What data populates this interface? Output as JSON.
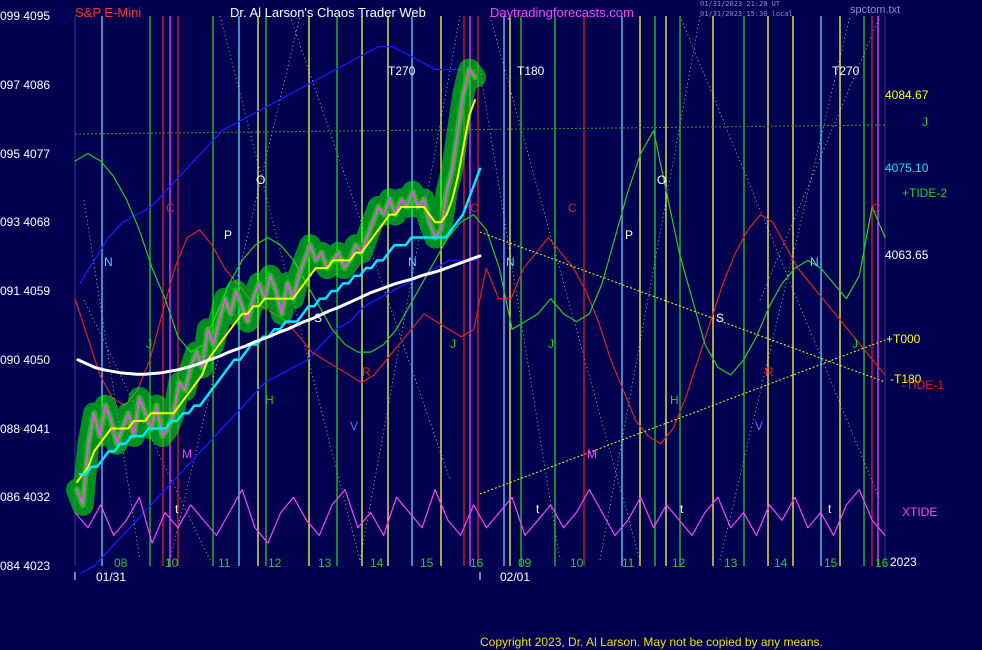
{
  "header": {
    "symbol": "S&P E-Mini",
    "author": "Dr. Al Larson's Chaos Trader Web",
    "site": "Daytradingforecasts.com",
    "stamp_line1": "01/31/2023 21:20 UT",
    "stamp_line2": "01/31/2023 15:30 local",
    "file": "spctom.txt"
  },
  "footer": {
    "copyright": "Copyright 2023, Dr. Al Larson. May not be copied by any means."
  },
  "colors": {
    "background": "#000050",
    "price_bar": "#00d000",
    "price_glow": "#00ff00",
    "fast_avg": "#ffff00",
    "mid_avg": "#00e8ff",
    "slow_avg": "#ffffff",
    "tide1": "#e02020",
    "tide2": "#20d020",
    "xtide": "#ff40ff",
    "envelope": "#1a1aff",
    "neptune_line": "#5cd8ff",
    "vertical_green": "#20d020",
    "vertical_yellow": "#ffff40",
    "vertical_red": "#e02020",
    "vertical_magenta": "#ff40ff"
  },
  "chart_data": {
    "type": "line",
    "title": "S&P E-Mini",
    "ylim": [
      4023,
      4095
    ],
    "y_ticks": [
      {
        "left": "099",
        "right": "4095",
        "value": 4095
      },
      {
        "left": "097",
        "right": "4086",
        "value": 4086
      },
      {
        "left": "095",
        "right": "4077",
        "value": 4077
      },
      {
        "left": "093",
        "right": "4068",
        "value": 4068
      },
      {
        "left": "091",
        "right": "4059",
        "value": 4059
      },
      {
        "left": "090",
        "right": "4050",
        "value": 4050
      },
      {
        "left": "088",
        "right": "4041",
        "value": 4041
      },
      {
        "left": "086",
        "right": "4032",
        "value": 4032
      },
      {
        "left": "084",
        "right": "4023",
        "value": 4023
      }
    ],
    "hour_labels": [
      "08",
      "10",
      "11",
      "12",
      "13",
      "14",
      "15",
      "16",
      "09",
      "10",
      "11",
      "12",
      "13",
      "14",
      "15",
      "16"
    ],
    "date_labels": [
      "01/31",
      "02/01"
    ],
    "right_levels": [
      {
        "label": "4084.67",
        "value": 4084.67,
        "color": "#ffff00"
      },
      {
        "label": "4075.10",
        "value": 4075.1,
        "color": "#00e8ff"
      },
      {
        "label": "4063.65",
        "value": 4063.65,
        "color": "#ffffff"
      }
    ],
    "right_series_labels": [
      {
        "label": "J",
        "color": "#20d020"
      },
      {
        "label": "+TIDE-2",
        "color": "#20d020"
      },
      {
        "label": "+T000",
        "color": "#ffff00"
      },
      {
        "label": "-T180",
        "color": "#ffff00"
      },
      {
        "label": "-TIDE-1",
        "color": "#e02020"
      },
      {
        "label": "XTIDE",
        "color": "#ff40ff"
      },
      {
        "label": "2023",
        "color": "#ffffff"
      }
    ],
    "time_markers": [
      {
        "label": "T270",
        "color": "#ffffff"
      },
      {
        "label": "T180",
        "color": "#ffffff"
      },
      {
        "label": "T270",
        "color": "#ffffff"
      }
    ],
    "planet_letters": [
      {
        "label": "N",
        "color": "#5cd8ff"
      },
      {
        "label": "C",
        "color": "#e02020"
      },
      {
        "label": "P",
        "color": "#ffffff"
      },
      {
        "label": "O",
        "color": "#ffffff"
      },
      {
        "label": "J",
        "color": "#20d020"
      },
      {
        "label": "S",
        "color": "#ffffff"
      },
      {
        "label": "H",
        "color": "#20d020"
      },
      {
        "label": "M",
        "color": "#ff40ff"
      },
      {
        "label": "R",
        "color": "#e02020"
      },
      {
        "label": "V",
        "color": "#6a6aff"
      },
      {
        "label": "t",
        "color": "#ffffff"
      },
      {
        "label": "N",
        "color": "#5cd8ff"
      },
      {
        "label": "J",
        "color": "#20d020"
      },
      {
        "label": "N",
        "color": "#5cd8ff"
      },
      {
        "label": "C",
        "color": "#e02020"
      },
      {
        "label": "C",
        "color": "#e02020"
      },
      {
        "label": "P",
        "color": "#ffffff"
      },
      {
        "label": "O",
        "color": "#ffffff"
      },
      {
        "label": "J",
        "color": "#20d020"
      },
      {
        "label": "S",
        "color": "#ffffff"
      },
      {
        "label": "M",
        "color": "#ff40ff"
      },
      {
        "label": "H",
        "color": "#20d020"
      },
      {
        "label": "R",
        "color": "#e02020"
      },
      {
        "label": "N",
        "color": "#5cd8ff"
      },
      {
        "label": "J",
        "color": "#20d020"
      },
      {
        "label": "C",
        "color": "#e02020"
      },
      {
        "label": "V",
        "color": "#6a6aff"
      },
      {
        "label": "t",
        "color": "#ffffff"
      },
      {
        "label": "t",
        "color": "#ffffff"
      },
      {
        "label": "t",
        "color": "#ffffff"
      }
    ],
    "price": [
      4033,
      4031,
      4039,
      4043,
      4040,
      4044,
      4042,
      4039,
      4041,
      4043,
      4040,
      4045,
      4043,
      4041,
      4044,
      4040,
      4041,
      4043,
      4047,
      4046,
      4049,
      4051,
      4049,
      4054,
      4052,
      4055,
      4058,
      4056,
      4059,
      4057,
      4055,
      4058,
      4060,
      4058,
      4061,
      4059,
      4056,
      4060,
      4058,
      4061,
      4063,
      4065,
      4063,
      4064,
      4062,
      4063,
      4064,
      4062,
      4063,
      4065,
      4064,
      4066,
      4068,
      4070,
      4069,
      4071,
      4069,
      4071,
      4070,
      4072,
      4070,
      4071,
      4068,
      4066,
      4067,
      4072,
      4075,
      4080,
      4085,
      4088,
      4087
    ],
    "fast_avg": [
      4034,
      4035,
      4036,
      4038,
      4039,
      4040,
      4041,
      4041,
      4041,
      4041,
      4042,
      4042,
      4042,
      4043,
      4043,
      4043,
      4043,
      4043,
      4044,
      4045,
      4046,
      4047,
      4048,
      4050,
      4051,
      4052,
      4053,
      4054,
      4055,
      4056,
      4056,
      4057,
      4057,
      4058,
      4058,
      4058,
      4058,
      4058,
      4058,
      4059,
      4060,
      4061,
      4062,
      4062,
      4062,
      4063,
      4063,
      4063,
      4063,
      4064,
      4064,
      4065,
      4066,
      4067,
      4068,
      4069,
      4069,
      4070,
      4070,
      4070,
      4070,
      4070,
      4069,
      4068,
      4068,
      4069,
      4071,
      4074,
      4078,
      4082,
      4084
    ],
    "mid_avg": [
      4035,
      4035,
      4036,
      4036,
      4037,
      4038,
      4038,
      4039,
      4039,
      4040,
      4040,
      4040,
      4041,
      4041,
      4041,
      4041,
      4042,
      4042,
      4043,
      4043,
      4044,
      4044,
      4045,
      4046,
      4047,
      4048,
      4049,
      4050,
      4050,
      4051,
      4052,
      4052,
      4053,
      4053,
      4054,
      4054,
      4055,
      4055,
      4055,
      4056,
      4057,
      4057,
      4058,
      4058,
      4059,
      4059,
      4060,
      4060,
      4061,
      4061,
      4062,
      4062,
      4063,
      4063,
      4064,
      4065,
      4065,
      4065,
      4066,
      4066,
      4066,
      4066,
      4066,
      4066,
      4066,
      4067,
      4068,
      4069,
      4071,
      4073,
      4075
    ],
    "slow_avg": [
      4050,
      4049.5,
      4049,
      4048.7,
      4048.5,
      4048.3,
      4048.2,
      4048.1,
      4048.1,
      4048.2,
      4048.3,
      4048.5,
      4048.7,
      4049,
      4049.3,
      4049.7,
      4050.1,
      4050.5,
      4051,
      4051.4,
      4051.8,
      4052.3,
      4052.7,
      4053.1,
      4053.6,
      4054,
      4054.5,
      4055,
      4055.4,
      4055.9,
      4056.4,
      4056.8,
      4057.3,
      4057.8,
      4058.3,
      4058.8,
      4059.2,
      4059.6,
      4060,
      4060.3,
      4060.6,
      4061,
      4061.3,
      4061.6,
      4062,
      4062.4,
      4062.8,
      4063.2,
      4063.6
    ],
    "tide1": [
      4058,
      4053,
      4048,
      4045,
      4044,
      4046,
      4050,
      4056,
      4062,
      4066,
      4067,
      4065,
      4062,
      4060,
      4058,
      4057,
      4056,
      4055,
      4053,
      4051,
      4050,
      4049,
      4048,
      4047,
      4048,
      4050,
      4052,
      4054,
      4056,
      4055,
      4054,
      4053,
      4054,
      4062,
      4058,
      4058,
      4062,
      4064,
      4066,
      4064,
      4062,
      4059,
      4055,
      4050,
      4046,
      4042,
      4040,
      4039,
      4041,
      4045,
      4050,
      4055,
      4060,
      4064,
      4067,
      4069,
      4068,
      4065,
      4062,
      4060,
      4058,
      4056,
      4054,
      4052,
      4050,
      4048
    ],
    "tide2": [
      4076,
      4077,
      4076,
      4074,
      4071,
      4067,
      4062,
      4058,
      4053,
      4051,
      4052,
      4056,
      4060,
      4063,
      4065,
      4066,
      4065,
      4063,
      4060,
      4057,
      4054,
      4052,
      4051,
      4051,
      4052,
      4054,
      4057,
      4060,
      4063,
      4066,
      4068,
      4069,
      4067,
      4062,
      4054,
      4055,
      4056,
      4058,
      4056,
      4055,
      4056,
      4060,
      4066,
      4072,
      4077,
      4080,
      4072,
      4064,
      4058,
      4052,
      4049,
      4048,
      4050,
      4053,
      4057,
      4060,
      4062,
      4063,
      4062,
      4060,
      4058,
      4061,
      4070,
      4066
    ],
    "xtide": [
      4030,
      4028,
      4031,
      4027,
      4029,
      4032,
      4026,
      4030,
      4028,
      4031,
      4029,
      4027,
      4030,
      4033,
      4028,
      4026,
      4030,
      4032,
      4029,
      4027,
      4031,
      4033,
      4028,
      4030,
      4027,
      4032,
      4030,
      4028,
      4033,
      4029,
      4027,
      4031,
      4028,
      4030,
      4032,
      4027,
      4029,
      4031,
      4028,
      4030,
      4033,
      4030,
      4027,
      4029,
      4032,
      4028,
      4031,
      4029,
      4027,
      4030,
      4032,
      4028,
      4030,
      4027,
      4031,
      4029,
      4032,
      4028,
      4030,
      4027,
      4031,
      4033,
      4029,
      4027
    ],
    "envelope_upper": [
      4060,
      4063,
      4066,
      4068,
      4069,
      4070,
      4072,
      4074,
      4076,
      4078,
      4080,
      4081,
      4082,
      4083,
      4084,
      4085,
      4086,
      4087,
      4088,
      4089,
      4090,
      4091,
      4091,
      4090,
      4089,
      4088,
      4088,
      4088,
      4087
    ],
    "envelope_lower": [
      4022,
      4023,
      4025,
      4027,
      4029,
      4031,
      4033,
      4035,
      4037,
      4039,
      4041,
      4043,
      4045,
      4047,
      4048,
      4049,
      4050,
      4052,
      4054,
      4055,
      4057,
      4058,
      4059,
      4060,
      4061,
      4062,
      4063,
      4063,
      4063
    ]
  }
}
